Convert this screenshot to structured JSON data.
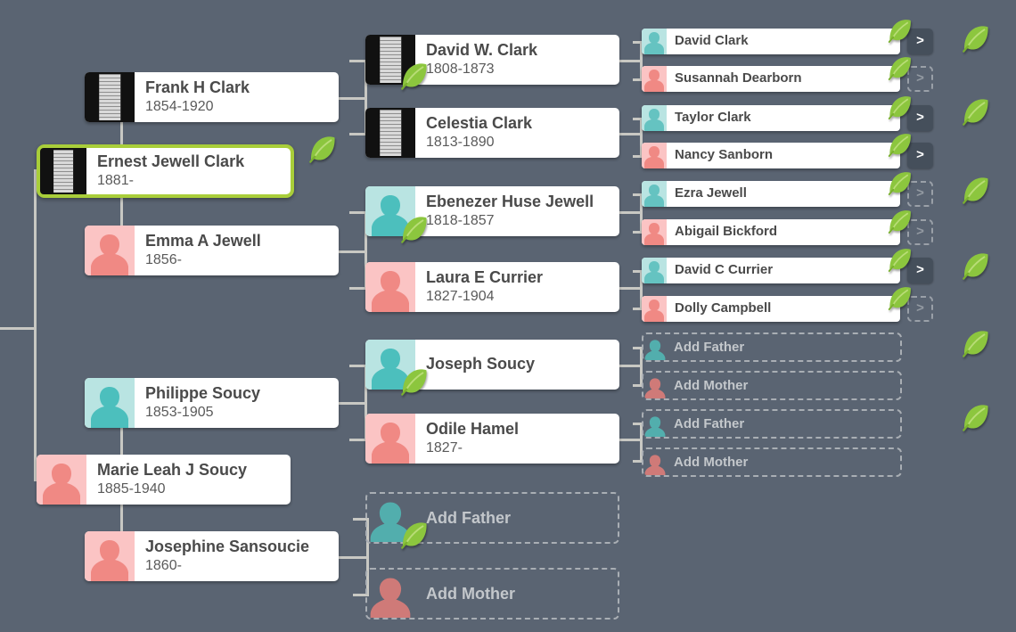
{
  "theme": {
    "background": "#5a6472",
    "card_bg": "#ffffff",
    "connector": "#c8c8c3",
    "selected_border": "#a9ce3a",
    "male_tint": "#b9e4e2",
    "female_tint": "#fbc4c4",
    "male_figure": "#4cbfbd",
    "female_figure": "#f08984",
    "placeholder_border": "#a9aeb4",
    "placeholder_text": "#c3c7cb",
    "chevron_bg": "#454f5b",
    "leaf_green": "#8dc63f"
  },
  "icons": {
    "leaf": "leaf-hint-icon",
    "chevron": "chevron-right-icon",
    "person_male": "male-silhouette-icon",
    "person_female": "female-silhouette-icon",
    "document": "document-thumbnail-icon"
  },
  "people": {
    "ernest": {
      "name": "Ernest Jewell Clark",
      "dates": "1881-"
    },
    "frank": {
      "name": "Frank H Clark",
      "dates": "1854-1920"
    },
    "emma": {
      "name": "Emma A Jewell",
      "dates": "1856-"
    },
    "davidw": {
      "name": "David W. Clark",
      "dates": "1808-1873"
    },
    "celestia": {
      "name": "Celestia Clark",
      "dates": "1813-1890"
    },
    "ebenezer": {
      "name": "Ebenezer Huse Jewell",
      "dates": "1818-1857"
    },
    "laura": {
      "name": "Laura E Currier",
      "dates": "1827-1904"
    },
    "marie": {
      "name": "Marie Leah J Soucy",
      "dates": "1885-1940"
    },
    "philippe": {
      "name": "Philippe Soucy",
      "dates": "1853-1905"
    },
    "josephine": {
      "name": "Josephine Sansoucie",
      "dates": "1860-"
    },
    "joseph": {
      "name": "Joseph Soucy",
      "dates": ""
    },
    "odile": {
      "name": "Odile Hamel",
      "dates": "1827-"
    },
    "davidclark": {
      "name": "David Clark"
    },
    "susannah": {
      "name": "Susannah Dearborn"
    },
    "taylor": {
      "name": "Taylor Clark"
    },
    "nancy": {
      "name": "Nancy Sanborn"
    },
    "ezra": {
      "name": "Ezra Jewell"
    },
    "abigail": {
      "name": "Abigail Bickford"
    },
    "davidc": {
      "name": "David C Currier"
    },
    "dolly": {
      "name": "Dolly Campbell"
    }
  },
  "placeholders": {
    "joseph_father": "Add Father",
    "joseph_mother": "Add Mother",
    "odile_father": "Add Father",
    "odile_mother": "Add Mother",
    "josephine_father": "Add Father",
    "josephine_mother": "Add Mother"
  },
  "chevrons": {
    "davidclark": ">",
    "susannah": ">",
    "taylor": ">",
    "nancy": ">",
    "ezra": ">",
    "abigail": ">",
    "davidc": ">",
    "dolly": ">"
  }
}
